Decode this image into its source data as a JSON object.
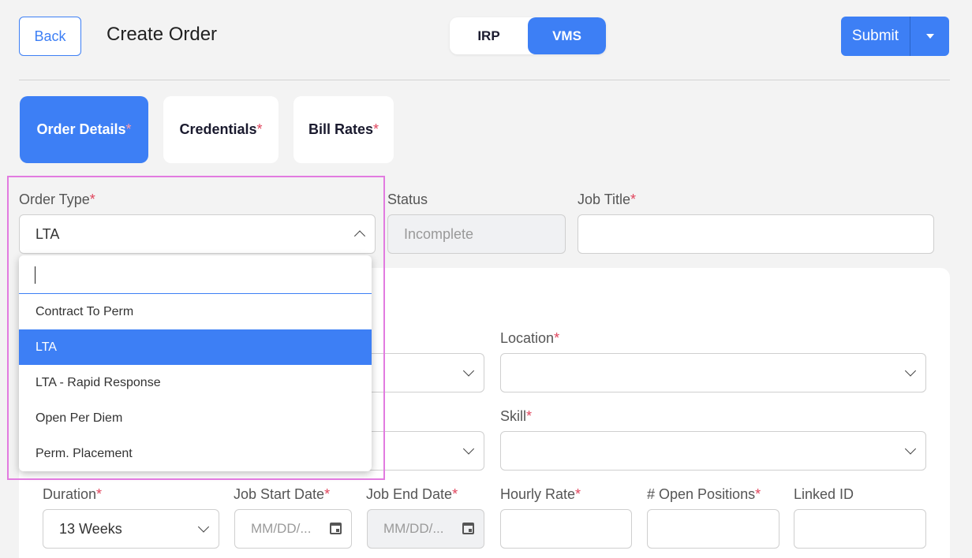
{
  "header": {
    "back_label": "Back",
    "title": "Create Order",
    "modes": [
      "IRP",
      "VMS"
    ],
    "active_mode": "VMS",
    "submit_label": "Submit"
  },
  "tabs": [
    {
      "label": "Order Details",
      "required": "*",
      "active": true
    },
    {
      "label": "Credentials",
      "required": "*",
      "active": false
    },
    {
      "label": "Bill Rates",
      "required": "*",
      "active": false
    }
  ],
  "fields": {
    "order_type": {
      "label": "Order Type",
      "required": "*",
      "value": "LTA"
    },
    "status": {
      "label": "Status",
      "value": "Incomplete"
    },
    "job_title": {
      "label": "Job Title",
      "required": "*",
      "value": ""
    },
    "location": {
      "label": "Location",
      "required": "*",
      "value": ""
    },
    "skill": {
      "label": "Skill",
      "required": "*",
      "value": ""
    },
    "duration": {
      "label": "Duration",
      "required": "*",
      "value": "13 Weeks"
    },
    "job_start_date": {
      "label": "Job Start Date",
      "required": "*",
      "placeholder": "MM/DD/..."
    },
    "job_end_date": {
      "label": "Job End Date",
      "required": "*",
      "placeholder": "MM/DD/..."
    },
    "hourly_rate": {
      "label": "Hourly Rate",
      "required": "*",
      "value": ""
    },
    "open_positions": {
      "label": "# Open Positions",
      "required": "*",
      "value": ""
    },
    "linked_id": {
      "label": "Linked ID",
      "value": ""
    }
  },
  "order_type_dropdown": {
    "search_value": "",
    "options": [
      "Contract To Perm",
      "LTA",
      "LTA - Rapid Response",
      "Open Per Diem",
      "Perm. Placement"
    ],
    "selected": "LTA"
  },
  "colors": {
    "accent": "#3d7ff5",
    "required": "#e0445c",
    "highlight": "#e27be0",
    "background": "#f3f3f3"
  }
}
